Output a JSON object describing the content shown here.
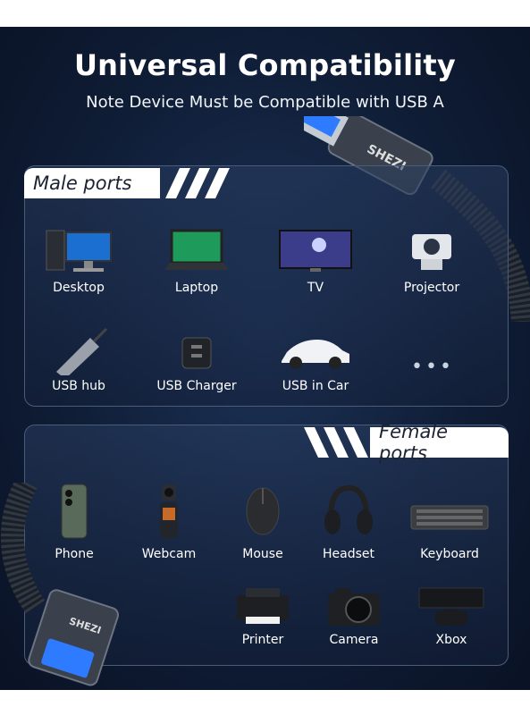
{
  "header": {
    "title": "Universal Compatibility",
    "subtitle": "Note Device Must be Compatible with USB A"
  },
  "male_section": {
    "tag": "Male ports",
    "items": [
      {
        "label": "Desktop",
        "icon": "desktop-icon"
      },
      {
        "label": "Laptop",
        "icon": "laptop-icon"
      },
      {
        "label": "TV",
        "icon": "tv-icon"
      },
      {
        "label": "Projector",
        "icon": "projector-icon"
      },
      {
        "label": "USB hub",
        "icon": "usb-hub-icon"
      },
      {
        "label": "USB Charger",
        "icon": "usb-charger-icon"
      },
      {
        "label": "USB in Car",
        "icon": "car-icon"
      }
    ],
    "more_indicator": "•••"
  },
  "female_section": {
    "tag": "Female ports",
    "items": [
      {
        "label": "Phone",
        "icon": "phone-icon"
      },
      {
        "label": "Webcam",
        "icon": "webcam-icon"
      },
      {
        "label": "Mouse",
        "icon": "mouse-icon"
      },
      {
        "label": "Headset",
        "icon": "headset-icon"
      },
      {
        "label": "Keyboard",
        "icon": "keyboard-icon"
      },
      {
        "label": "Printer",
        "icon": "printer-icon"
      },
      {
        "label": "Camera",
        "icon": "camera-icon"
      },
      {
        "label": "Xbox",
        "icon": "xbox-icon"
      }
    ]
  },
  "connector_brand_mark": "SHEZI",
  "colors": {
    "background": "#0f1d36",
    "panel_border": "#4a5c78",
    "usb_blue": "#2f7bff",
    "text": "#ffffff"
  }
}
